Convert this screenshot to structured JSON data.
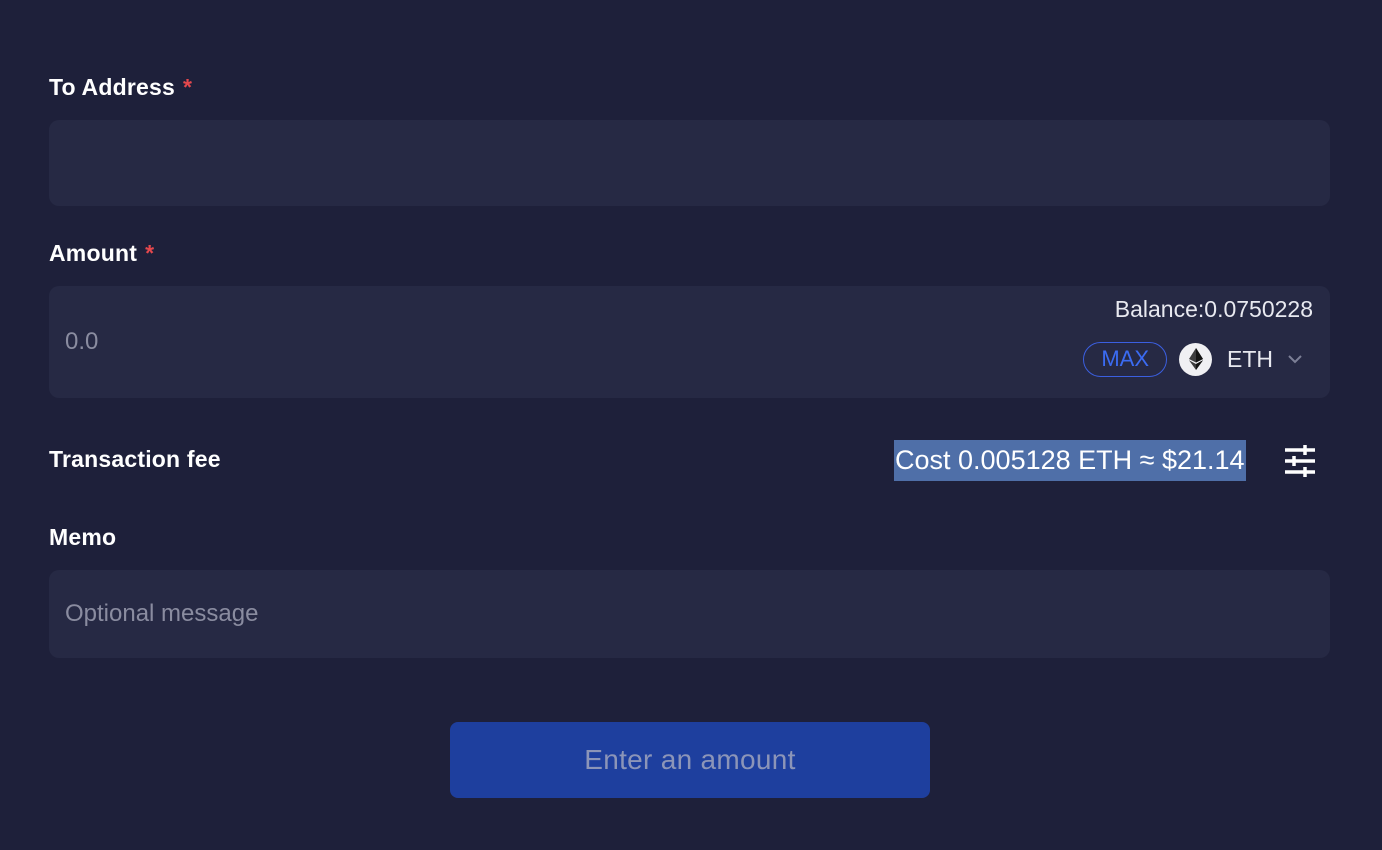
{
  "to_address": {
    "label": "To Address",
    "required_marker": "*",
    "value": "",
    "placeholder": ""
  },
  "amount": {
    "label": "Amount",
    "required_marker": "*",
    "value": "",
    "placeholder": "0.0",
    "balance_text": "Balance:0.0750228",
    "max_label": "MAX",
    "token_icon": "ethereum-icon",
    "token_symbol": "ETH"
  },
  "transaction_fee": {
    "label": "Transaction fee",
    "cost_text": "Cost 0.005128 ETH ≈ $21.14",
    "selection_color": "#4f6fa8",
    "settings_icon": "sliders-icon"
  },
  "memo": {
    "label": "Memo",
    "value": "",
    "placeholder": "Optional message"
  },
  "submit": {
    "label": "Enter an amount",
    "disabled": true
  },
  "colors": {
    "background": "#1e203a",
    "field_background": "#262944",
    "required": "#e5484d",
    "accent": "#3b6bf2",
    "button": "#1e3f9e"
  }
}
